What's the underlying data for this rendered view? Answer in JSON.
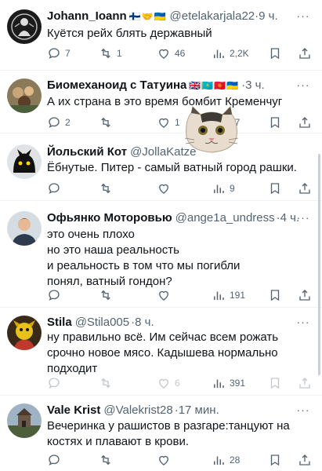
{
  "tweets": [
    {
      "name": "Johann_Ioann",
      "flags": "🇫🇮🤝🇺🇦",
      "handle": "@etelakarjala22",
      "time": "9 ч.",
      "text": "Куётся рейх блять державный",
      "replies": "7",
      "retweets": "1",
      "likes": "46",
      "views": "2,2K"
    },
    {
      "name": "Биомеханоид с Татуина",
      "flags": "🇬🇧🇰🇿🇰🇬🇺🇦",
      "handle": "",
      "time": "3 ч.",
      "text": "А их страна в это время бомбит Кременчуг",
      "replies": "2",
      "retweets": "",
      "likes": "1",
      "views": "57"
    },
    {
      "name": "Йольский Кот",
      "flags": "",
      "handle": "@JollaKatze",
      "time": "",
      "text": "Ёбнутые. Питер - самый ватный город рашки.",
      "replies": "",
      "retweets": "",
      "likes": "",
      "views": "9"
    },
    {
      "name": "Офьянко Моторовью",
      "flags": "",
      "handle": "@ange1a_undress",
      "time": "4 ч.",
      "text": "это очень плохо\nно это наша реальность\nи реальность в том что мы погибли\nпонял, ватный гондон?",
      "replies": "",
      "retweets": "",
      "likes": "",
      "views": "191"
    },
    {
      "name": "Stila",
      "flags": "",
      "handle": "@Stila005",
      "time": "8 ч.",
      "text": "ну правильно всё.  Им сейчас всем рожать срочно новое мясо. Кадышева нормально подходит",
      "replies": "",
      "retweets": "",
      "likes": "6",
      "views": "391"
    },
    {
      "name": "Vale Krist",
      "flags": "",
      "handle": "@Valekrist28",
      "time": "17 мин.",
      "text": "Вечеринка у рашистов в разгаре:танцуют на костях и плавают в крови.",
      "replies": "",
      "retweets": "",
      "likes": "",
      "views": "28"
    }
  ],
  "separator": "·",
  "colors": {
    "text": "#0f1419",
    "muted": "#536471",
    "divider": "#eff3f4"
  },
  "icons": [
    "reply-icon",
    "retweet-icon",
    "like-icon",
    "views-icon",
    "bookmark-icon",
    "share-icon",
    "more-icon"
  ]
}
